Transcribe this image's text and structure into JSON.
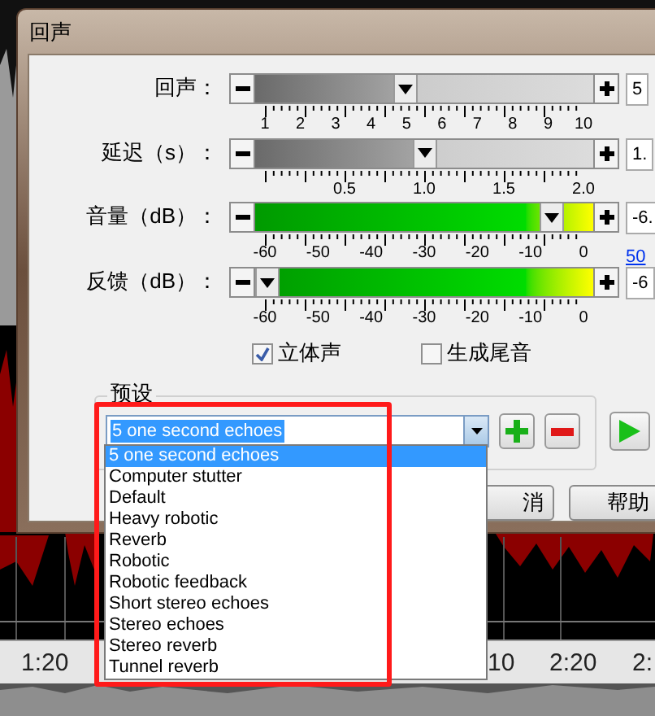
{
  "window": {
    "title": "回声"
  },
  "sliders": [
    {
      "kind": "count",
      "label": "回声：",
      "level": 0.44,
      "value": "5",
      "ticks": [
        "1",
        "2",
        "3",
        "4",
        "5",
        "6",
        "7",
        "8",
        "9",
        "10"
      ]
    },
    {
      "kind": "seconds",
      "label": "延迟（s）：",
      "level": 0.5,
      "value": "1.",
      "ticks": [
        "0.5",
        "1.0",
        "1.5",
        "2.0"
      ]
    },
    {
      "kind": "db",
      "label": "音量（dB）：",
      "level": 0.9,
      "value": "-6.",
      "link": "50",
      "ticks": [
        "-60",
        "-50",
        "-40",
        "-30",
        "-20",
        "-10",
        "0"
      ]
    },
    {
      "kind": "db",
      "label": "反馈（dB）：",
      "level": 0,
      "value": "-6",
      "ticks": [
        "-60",
        "-50",
        "-40",
        "-30",
        "-20",
        "-10",
        "0"
      ]
    }
  ],
  "options": [
    {
      "label": "立体声",
      "checked": true
    },
    {
      "label": "生成尾音",
      "checked": false
    }
  ],
  "presets": {
    "title": "预设",
    "value": "5 one second echoes",
    "items": [
      {
        "label": "5 one second echoes",
        "selected": true
      },
      {
        "label": "Computer stutter",
        "selected": false
      },
      {
        "label": "Default",
        "selected": false
      },
      {
        "label": "Heavy robotic",
        "selected": false
      },
      {
        "label": "Reverb",
        "selected": false
      },
      {
        "label": "Robotic",
        "selected": false
      },
      {
        "label": "Robotic feedback",
        "selected": false
      },
      {
        "label": "Short stereo echoes",
        "selected": false
      },
      {
        "label": "Stereo echoes",
        "selected": false
      },
      {
        "label": "Stereo reverb",
        "selected": false
      },
      {
        "label": "Tunnel reverb",
        "selected": false
      }
    ]
  },
  "buttons": [
    "消",
    "帮助"
  ],
  "timeline": [
    "1:20",
    "10",
    "2:20",
    "2:"
  ]
}
